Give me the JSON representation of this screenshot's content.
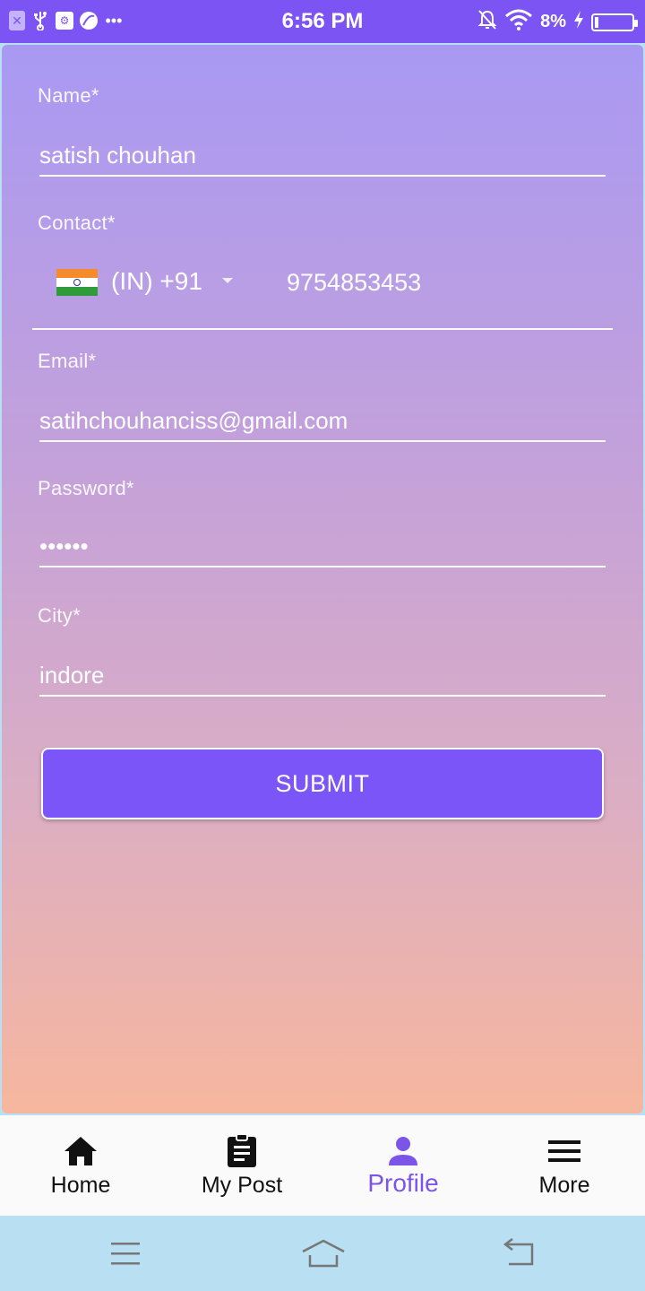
{
  "status_bar": {
    "time": "6:56 PM",
    "battery": "8%",
    "icons_left": [
      "close-notification-icon",
      "usb-icon",
      "usb-debug-icon",
      "app-icon",
      "more-dots-icon"
    ],
    "icons_right": [
      "mute-icon",
      "wifi-icon",
      "charging-icon",
      "battery-icon"
    ]
  },
  "form": {
    "name": {
      "label": "Name*",
      "value": "satish chouhan"
    },
    "contact": {
      "label": "Contact*",
      "country": "(IN)  +91",
      "value": "9754853453"
    },
    "email": {
      "label": "Email*",
      "value": "satihchouhanciss@gmail.com"
    },
    "password": {
      "label": "Password*",
      "value": "••••••"
    },
    "city": {
      "label": "City*",
      "value": "indore"
    },
    "submit_label": "SUBMIT"
  },
  "bottom_nav": {
    "items": [
      {
        "label": "Home",
        "icon": "home-icon"
      },
      {
        "label": "My Post",
        "icon": "clipboard-icon"
      },
      {
        "label": "Profile",
        "icon": "person-icon",
        "active": true
      },
      {
        "label": "More",
        "icon": "menu-icon"
      }
    ],
    "active_color": "#7b55e8"
  },
  "colors": {
    "status_bar": "#7d54f4",
    "button": "#7b55f7",
    "gradient_top": "#a999f3",
    "gradient_bottom": "#f7b79e",
    "system_nav": "#b8dff2"
  }
}
